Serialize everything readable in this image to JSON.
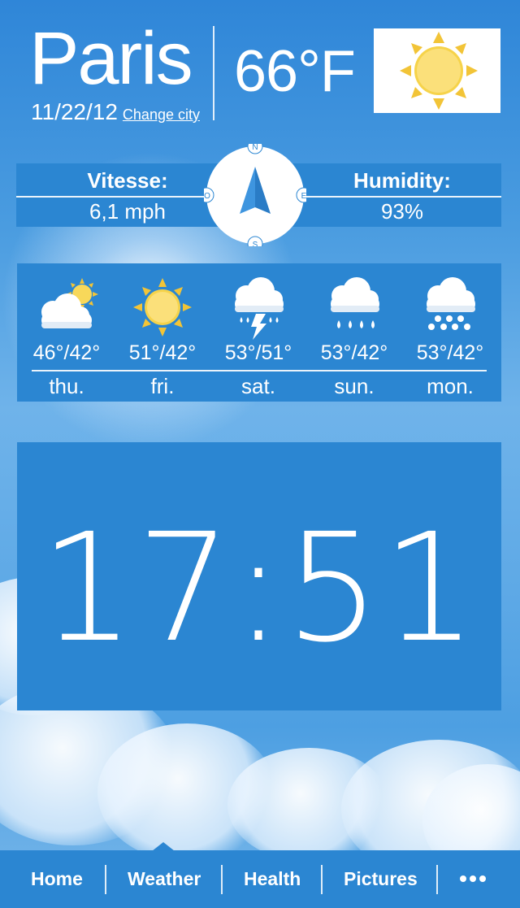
{
  "header": {
    "city": "Paris",
    "date": "11/22/12",
    "change_city_label": "Change city",
    "temperature": "66°F",
    "current_condition_icon": "sun-icon"
  },
  "stats": {
    "wind_label": "Vitesse:",
    "wind_value": "6,1 mph",
    "humidity_label": "Humidity:",
    "humidity_value": "93%",
    "compass": {
      "n": "N",
      "s": "S",
      "e": "E",
      "o": "O"
    }
  },
  "forecast": [
    {
      "temp": "46°/42°",
      "day": "thu.",
      "icon": "partly-cloudy-icon"
    },
    {
      "temp": "51°/42°",
      "day": "fri.",
      "icon": "sun-icon"
    },
    {
      "temp": "53°/51°",
      "day": "sat.",
      "icon": "thunderstorm-icon"
    },
    {
      "temp": "53°/42°",
      "day": "sun.",
      "icon": "rain-icon"
    },
    {
      "temp": "53°/42°",
      "day": "mon.",
      "icon": "snow-icon"
    }
  ],
  "clock": {
    "time": "17:51"
  },
  "nav": {
    "items": [
      "Home",
      "Weather",
      "Health",
      "Pictures"
    ],
    "active": "Weather",
    "more_icon": "more-dots-icon"
  },
  "colors": {
    "panel": "#2b86d2",
    "sun_yellow": "#f6d34a"
  }
}
